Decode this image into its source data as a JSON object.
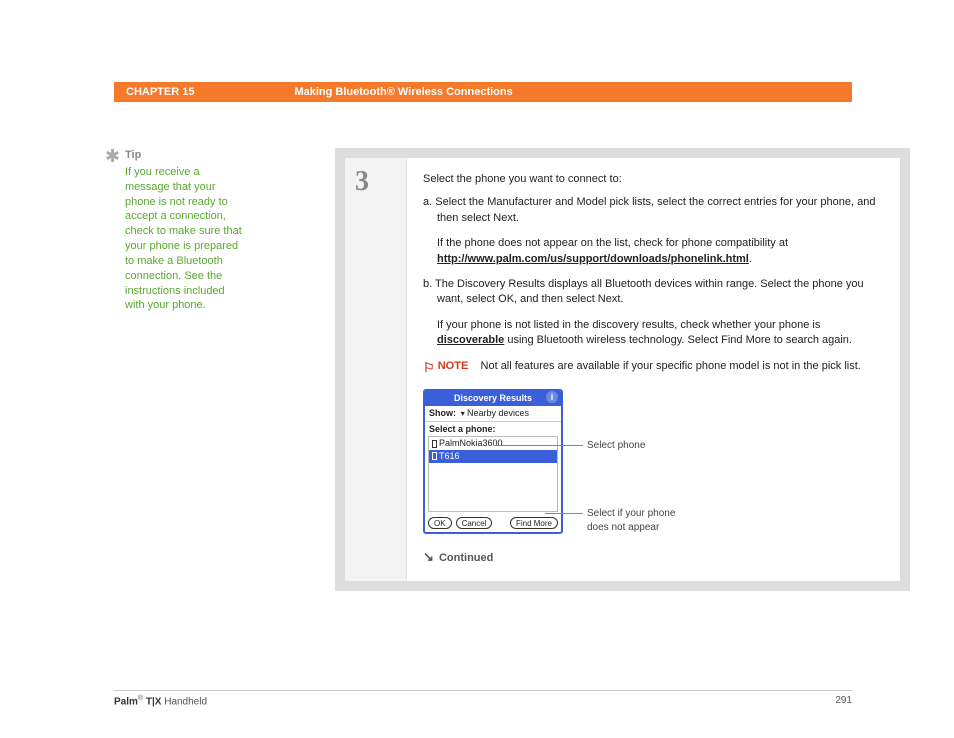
{
  "header": {
    "chapter": "CHAPTER 15",
    "title": "Making Bluetooth® Wireless Connections"
  },
  "tip": {
    "heading": "Tip",
    "text": "If you receive a message that your phone is not ready to accept a connection, check to make sure that your phone is prepared to make a Bluetooth connection. See the instructions included with your phone."
  },
  "step": {
    "number": "3",
    "intro": "Select the phone you want to connect to:",
    "item_a_prefix": "a.  ",
    "item_a": "Select the Manufacturer and Model pick lists, select the correct entries for your phone, and then select Next.",
    "item_a_note_1": "If the phone does not appear on the list, check for phone compatibility at ",
    "item_a_link": "http://www.palm.com/us/support/downloads/phonelink.html",
    "item_a_note_2": ".",
    "item_b_prefix": "b.  ",
    "item_b": "The Discovery Results displays all Bluetooth devices within range. Select the phone you want, select OK, and then select Next.",
    "item_b_note_1": "If your phone is not listed in the discovery results, check whether your phone is ",
    "item_b_link": "discoverable",
    "item_b_note_2": " using Bluetooth wireless technology. Select Find More to search again."
  },
  "note": {
    "label": "NOTE",
    "body": "Not all features are available if your specific phone model is not in the pick list."
  },
  "device": {
    "title": "Discovery Results",
    "show_label": "Show:",
    "show_value": "Nearby devices",
    "select_label": "Select a phone:",
    "list": [
      {
        "name": "PalmNokia3600",
        "selected": false
      },
      {
        "name": "T616",
        "selected": true
      }
    ],
    "ok": "OK",
    "cancel": "Cancel",
    "find_more": "Find More"
  },
  "callouts": {
    "c1": "Select phone",
    "c2": "Select if your phone does not appear"
  },
  "continued": "Continued",
  "footer": {
    "product_bold": "Palm",
    "product_reg": "®",
    "product_model": " T|X",
    "product_suffix": " Handheld",
    "page": "291"
  }
}
